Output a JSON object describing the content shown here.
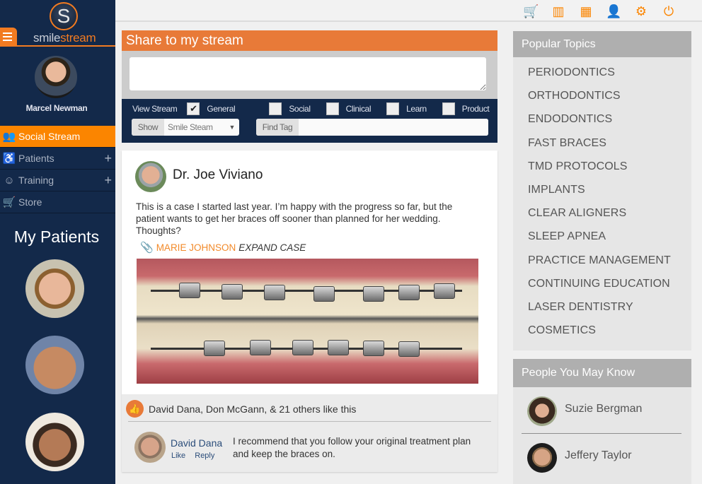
{
  "app": {
    "logo_letter": "S",
    "logo_text_a": "smile",
    "logo_text_b": "stream",
    "brand_color": "#f27b21"
  },
  "user": {
    "name": "Marcel Newman"
  },
  "sidebar": {
    "items": [
      {
        "label": "Social Stream",
        "icon": "people-icon",
        "glyph": "👥",
        "active": true,
        "expandable": false
      },
      {
        "label": "Patients",
        "icon": "dental-chair-icon",
        "glyph": "♿",
        "active": false,
        "expandable": true
      },
      {
        "label": "Training",
        "icon": "head-gear-icon",
        "glyph": "☺",
        "active": false,
        "expandable": true
      },
      {
        "label": "Store",
        "icon": "cart-icon",
        "glyph": "🛒",
        "active": false,
        "expandable": false
      }
    ],
    "expand_glyph": "+",
    "patients_title": "My Patients"
  },
  "topbar": {
    "icons": [
      {
        "name": "cart-icon",
        "glyph": "🛒"
      },
      {
        "name": "buildings-icon",
        "glyph": "▥"
      },
      {
        "name": "building-icon",
        "glyph": "▦"
      },
      {
        "name": "user-icon",
        "glyph": "👤"
      },
      {
        "name": "gear-icon",
        "glyph": "⚙"
      },
      {
        "name": "power-icon",
        "glyph": "⏻"
      }
    ]
  },
  "share": {
    "title": "Share to my stream",
    "input_value": "",
    "view_stream_label": "View Stream",
    "filters": [
      {
        "label": "General",
        "checked": true
      },
      {
        "label": "Social",
        "checked": false
      },
      {
        "label": "Clinical",
        "checked": false
      },
      {
        "label": "Learn",
        "checked": false
      },
      {
        "label": "Product",
        "checked": false
      }
    ],
    "check_glyph": "✔",
    "show_label": "Show",
    "show_value": "Smile Steam",
    "caret_glyph": "▼",
    "find_tag_label": "Find Tag",
    "find_tag_value": ""
  },
  "post": {
    "author": "Dr. Joe Viviano",
    "text": "This is a case I started last year. I’m happy with the progress so far, but the patient wants to get her braces off sooner than planned for her wedding. Thoughts?",
    "clip_glyph": "🔗",
    "case_name": "MARIE JOHNSON",
    "expand_label": "EXPAND CASE",
    "image_alt": "Teeth with braces",
    "likes_text": "David Dana, Don McGann, & 21 others like this",
    "like_glyph": "👍",
    "comment": {
      "author": "David Dana",
      "like_label": "Like",
      "reply_label": "Reply",
      "text": "I recommend that you follow your original treatment plan and keep the braces on."
    }
  },
  "topics": {
    "title": "Popular Topics",
    "items": [
      "PERIODONTICS",
      "ORTHODONTICS",
      "ENDODONTICS",
      "FAST BRACES",
      "TMD PROTOCOLS",
      "IMPLANTS",
      "CLEAR ALIGNERS",
      "SLEEP APNEA",
      "PRACTICE MANAGEMENT",
      "CONTINUING EDUCATION",
      "LASER DENTISTRY",
      "COSMETICS"
    ]
  },
  "people": {
    "title": "People You May Know",
    "items": [
      {
        "name": "Suzie Bergman"
      },
      {
        "name": "Jeffery Taylor"
      }
    ]
  }
}
